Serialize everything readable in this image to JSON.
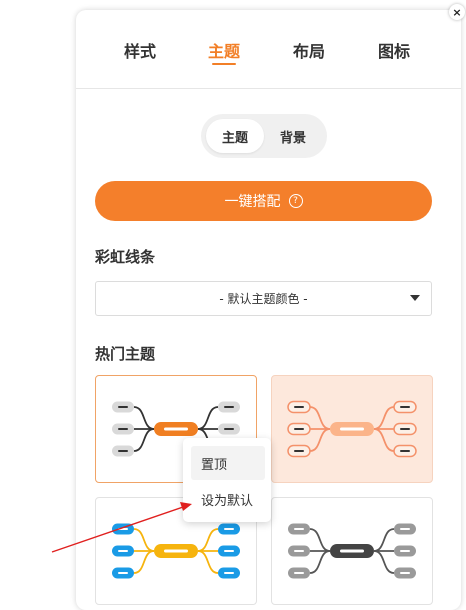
{
  "close_label": "×",
  "tabs": [
    {
      "label": "样式",
      "active": false
    },
    {
      "label": "主题",
      "active": true
    },
    {
      "label": "布局",
      "active": false
    },
    {
      "label": "图标",
      "active": false
    }
  ],
  "segment": [
    {
      "label": "主题",
      "active": true
    },
    {
      "label": "背景",
      "active": false
    }
  ],
  "one_key_button": {
    "label": "一键搭配",
    "icon": "help-icon",
    "glyph": "?"
  },
  "rainbow": {
    "title": "彩虹线条",
    "select_value": "- 默认主题颜色 -"
  },
  "popular": {
    "title": "热门主题",
    "themes": [
      {
        "name": "theme-gray-orange",
        "center": "#f07f22",
        "node": "#d9d9d9",
        "line": "#333333",
        "background": "#ffffff",
        "selected": true
      },
      {
        "name": "theme-peach",
        "center": "#fbb48a",
        "node": "#fcefe6",
        "line": "#f4916a",
        "background": "#fde8dc",
        "selected": false
      },
      {
        "name": "theme-blue-yellow",
        "center": "#f6b40e",
        "node": "#1a9be6",
        "line": "#f6b40e",
        "background": "#ffffff",
        "selected": false
      },
      {
        "name": "theme-gray-dark",
        "center": "#444444",
        "node": "#9a9a9a",
        "line": "#555555",
        "background": "#ffffff",
        "selected": false
      }
    ]
  },
  "context_menu": {
    "items": [
      {
        "label": "置顶",
        "hover": true
      },
      {
        "label": "设为默认",
        "hover": false
      }
    ]
  },
  "annotation_color": "#e0201f",
  "accent_color": "#f27f27"
}
